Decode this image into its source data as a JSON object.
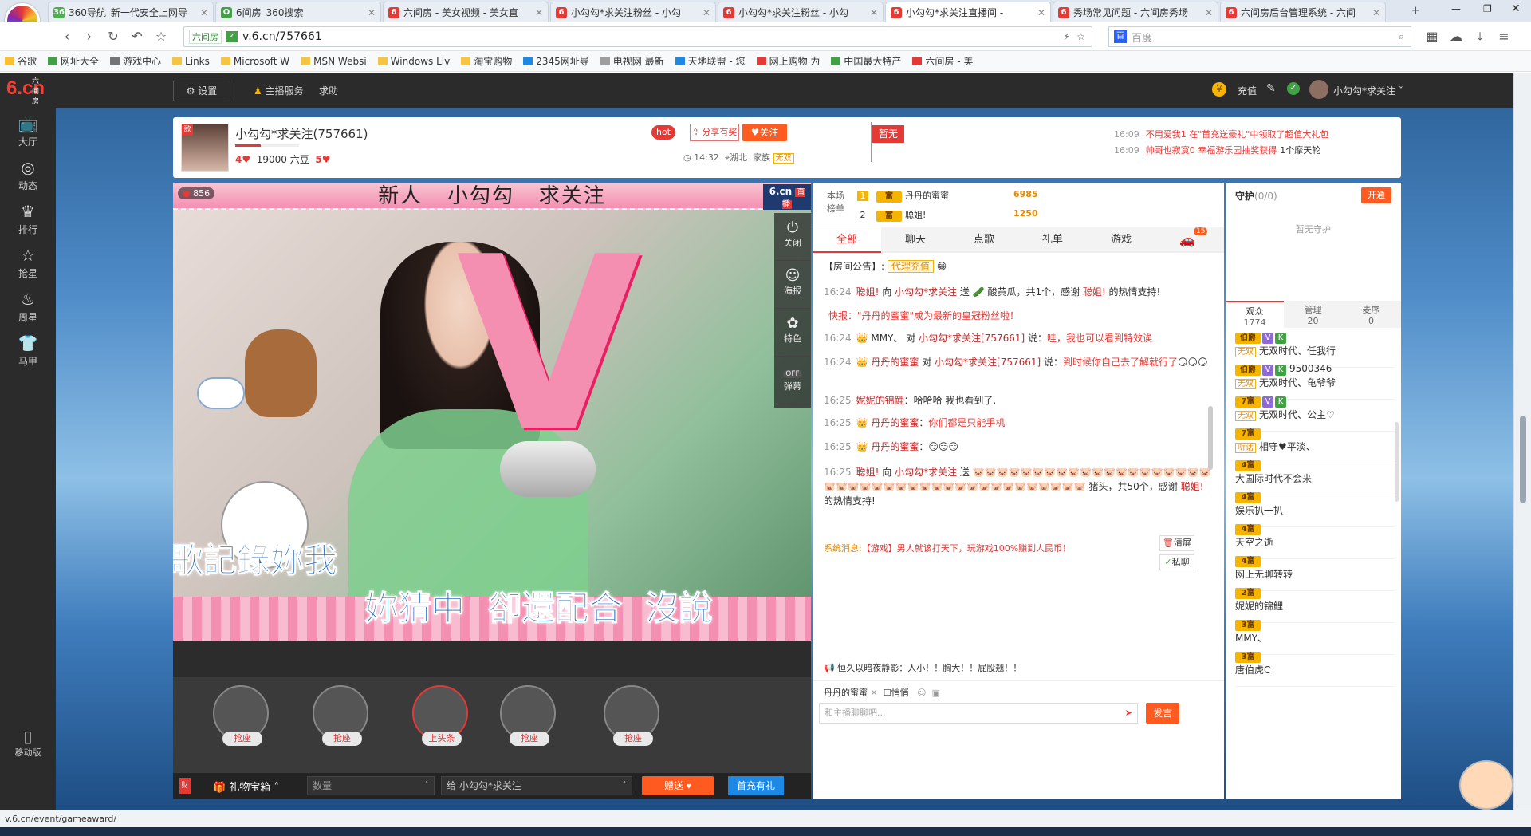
{
  "browser": {
    "tabs": [
      {
        "title": "360导航_新一代安全上网导",
        "color": "#4caf50",
        "active": false,
        "icon": "360"
      },
      {
        "title": "6间房_360搜索",
        "color": "#43a047",
        "active": false,
        "icon": "O"
      },
      {
        "title": "六间房 - 美女视频 - 美女直",
        "color": "#e53935",
        "active": false,
        "icon": "6"
      },
      {
        "title": "小勾勾*求关注粉丝 - 小勾",
        "color": "#e53935",
        "active": false,
        "icon": "6"
      },
      {
        "title": "小勾勾*求关注粉丝 - 小勾",
        "color": "#e53935",
        "active": false,
        "icon": "6"
      },
      {
        "title": "小勾勾*求关注直播间 - ",
        "color": "#e53935",
        "active": true,
        "icon": "6"
      },
      {
        "title": "秀场常见问题 - 六间房秀场",
        "color": "#e53935",
        "active": false,
        "icon": "6"
      },
      {
        "title": "六间房后台管理系统 - 六间",
        "color": "#e53935",
        "active": false,
        "icon": "6"
      }
    ],
    "site_tag": "六间房",
    "url": "v.6.cn/757661",
    "search_placeholder": "百度",
    "bookmarks": [
      {
        "label": "谷歌",
        "color": "#fbc02d"
      },
      {
        "label": "网址大全",
        "color": "#43a047"
      },
      {
        "label": "游戏中心",
        "color": "#757575"
      },
      {
        "label": "Links",
        "color": "#f5c542"
      },
      {
        "label": "Microsoft W",
        "color": "#f5c542"
      },
      {
        "label": "MSN Websi",
        "color": "#f5c542"
      },
      {
        "label": "Windows Liv",
        "color": "#f5c542"
      },
      {
        "label": "淘宝购物",
        "color": "#f5c542"
      },
      {
        "label": "2345网址导",
        "color": "#1e88e5"
      },
      {
        "label": "电视网 最新",
        "color": "#9e9e9e"
      },
      {
        "label": "天地联盟 - 您",
        "color": "#1e88e5"
      },
      {
        "label": "网上购物 为",
        "color": "#e53935"
      },
      {
        "label": "中国最大特产",
        "color": "#43a047"
      },
      {
        "label": "六间房 - 美",
        "color": "#e53935"
      }
    ],
    "status_url": "v.6.cn/event/gameaward/"
  },
  "site": {
    "logo": "6.cn",
    "logo_sub": "六间房",
    "settings": "设置",
    "anchor_service": "主播服务",
    "help": "求助",
    "recharge": "充值",
    "user": "小勾勾*求关注",
    "sidebar": [
      {
        "label": "大厅",
        "icon": "tv-icon"
      },
      {
        "label": "动态",
        "icon": "compass-icon"
      },
      {
        "label": "排行",
        "icon": "crown-icon"
      },
      {
        "label": "抢星",
        "icon": "star-icon"
      },
      {
        "label": "周星",
        "icon": "cup-icon"
      },
      {
        "label": "马甲",
        "icon": "shirt-icon"
      }
    ],
    "mobile": "移动版"
  },
  "room": {
    "avatar_tag": "歌",
    "name": "小勾勾*求关注(757661)",
    "hearts1": "4",
    "beans": "19000 六豆",
    "hearts2": "5",
    "hot": "hot",
    "share": "分享有奖",
    "follow": "关注",
    "time": "14:32",
    "location": "湖北",
    "family_label": "家族",
    "family_value": "无双",
    "flag": "暂无",
    "notices": [
      {
        "time": "16:09",
        "text": "不用爱我1 在\"首充送豪礼\"中领取了超值大礼包"
      },
      {
        "time": "16:09",
        "text": "帅哥也寂寞0 幸福游乐园抽奖获得",
        "tail": "1个摩天轮"
      }
    ]
  },
  "video": {
    "wealth": "856",
    "banner": "新人   小勾勾   求关注",
    "brand": "6.cn",
    "live": "直播",
    "controls": [
      {
        "label": "关闭",
        "icon": "power-icon"
      },
      {
        "label": "海报",
        "icon": "poster-icon"
      },
      {
        "label": "特色",
        "icon": "feature-icon"
      },
      {
        "label": "弹幕",
        "icon": "danmu-icon"
      }
    ],
    "danmu_off": "OFF",
    "big_letter": "V",
    "lyric1": "想做支歌記錄妳我",
    "lyric2": "妳猜中  卻還配合  沒說",
    "seat_label": "抢座",
    "headline": "上头条",
    "gift_box": "礼物宝箱",
    "qty_placeholder": "数量",
    "to_label": "给",
    "to_user": "小勾勾*求关注",
    "send": "赠送",
    "first_recharge": "首充有礼"
  },
  "chat": {
    "rank_title": "本场榜单",
    "rank": [
      {
        "pos": "1",
        "name": "丹丹的蜜蜜",
        "score": "6985"
      },
      {
        "pos": "2",
        "name": "聪姐!",
        "score": "1250"
      }
    ],
    "tabs": [
      "全部",
      "聊天",
      "点歌",
      "礼单",
      "游戏"
    ],
    "car_count": "15",
    "announcement": "【房间公告】:",
    "agent": "代理充值",
    "messages": [
      {
        "time": "16:24",
        "html": "<span class='nm'>聪姐!</span> 向 <span class='nm'>小勾勾*求关注</span> 送 🥒 酸黄瓜，共1个，感谢 <span class='nm'>聪姐!</span> 的热情支持!"
      },
      {
        "time": "",
        "html": "<span class='hl'>快报：\"丹丹的蜜蜜\"成为最新的皇冠粉丝啦！</span>"
      },
      {
        "time": "16:24",
        "html": "👑 MMY、 对 <span class='nm'>小勾勾*求关注[757661]</span> 说：<span class='hl'>哇，我也可以看到特效诶</span>"
      },
      {
        "time": "16:24",
        "html": "👑 <span class='nm'>丹丹的蜜蜜</span> 对 <span class='nm'>小勾勾*求关注[757661]</span> 说：<span class='hl'>到时候你自己去了解就行了</span>😏😏😏"
      },
      {
        "time": "16:25",
        "html": "<span class='nm'>妮妮的锦鲤</span>：哈哈哈 我也看到了."
      },
      {
        "time": "16:25",
        "html": "👑 <span class='nm'>丹丹的蜜蜜</span>：<span class='hl'>你们都是只能手机</span>"
      },
      {
        "time": "16:25",
        "html": "👑 <span class='nm'>丹丹的蜜蜜</span>：😏😏😏"
      },
      {
        "time": "16:25",
        "html": "<span class='nm'>聪姐!</span> 向 <span class='nm'>小勾勾*求关注</span> 送 🐷🐷🐷🐷🐷🐷🐷🐷🐷🐷🐷🐷🐷🐷🐷🐷🐷🐷🐷🐷🐷🐷🐷🐷🐷🐷🐷🐷🐷🐷🐷🐷🐷🐷🐷🐷🐷🐷🐷🐷🐷🐷 猪头，共50个，感谢 <span class='nm'>聪姐!</span> 的热情支持!"
      }
    ],
    "system": "系统消息:",
    "system_msg": "【游戏】男人就该打天下，玩游戏100%赚到人民币！",
    "clear": "清屏",
    "private": "私聊",
    "broadcast": "恒久以暗夜静影：人小！！胸大！！屁股翘！！",
    "target": "丹丹的蜜蜜",
    "whisper": "悄悄",
    "input_placeholder": "和主播聊聊吧...",
    "send": "发言"
  },
  "right": {
    "guard_title": "守护",
    "guard_count": "(0/0)",
    "open": "开通",
    "no_guard": "暂无守护",
    "tabs": [
      {
        "label": "观众",
        "count": "1774"
      },
      {
        "label": "管理",
        "count": "20"
      },
      {
        "label": "麦序",
        "count": "0"
      }
    ],
    "users": [
      {
        "lv": "伯爵",
        "name": "无双时代、任我行",
        "tag": "无双"
      },
      {
        "lv": "伯爵",
        "name": "无双时代、龟爷爷",
        "tag": "无双",
        "extra": "9500346"
      },
      {
        "lv": "7富",
        "name": "无双时代、公主♡",
        "tag": "无双"
      },
      {
        "lv": "7富",
        "name": "相守♥平淡、",
        "tag": "听话"
      },
      {
        "lv": "4富",
        "name": "大国际时代不会来",
        "tag": ""
      },
      {
        "lv": "4富",
        "name": "娱乐扒一扒",
        "tag": ""
      },
      {
        "lv": "4富",
        "name": "天空之逝",
        "tag": ""
      },
      {
        "lv": "4富",
        "name": "网上无聊转转",
        "tag": ""
      },
      {
        "lv": "2富",
        "name": "妮妮的锦鲤",
        "tag": ""
      },
      {
        "lv": "3富",
        "name": "MMY、",
        "tag": ""
      },
      {
        "lv": "3富",
        "name": "唐伯虎C",
        "tag": ""
      }
    ]
  }
}
